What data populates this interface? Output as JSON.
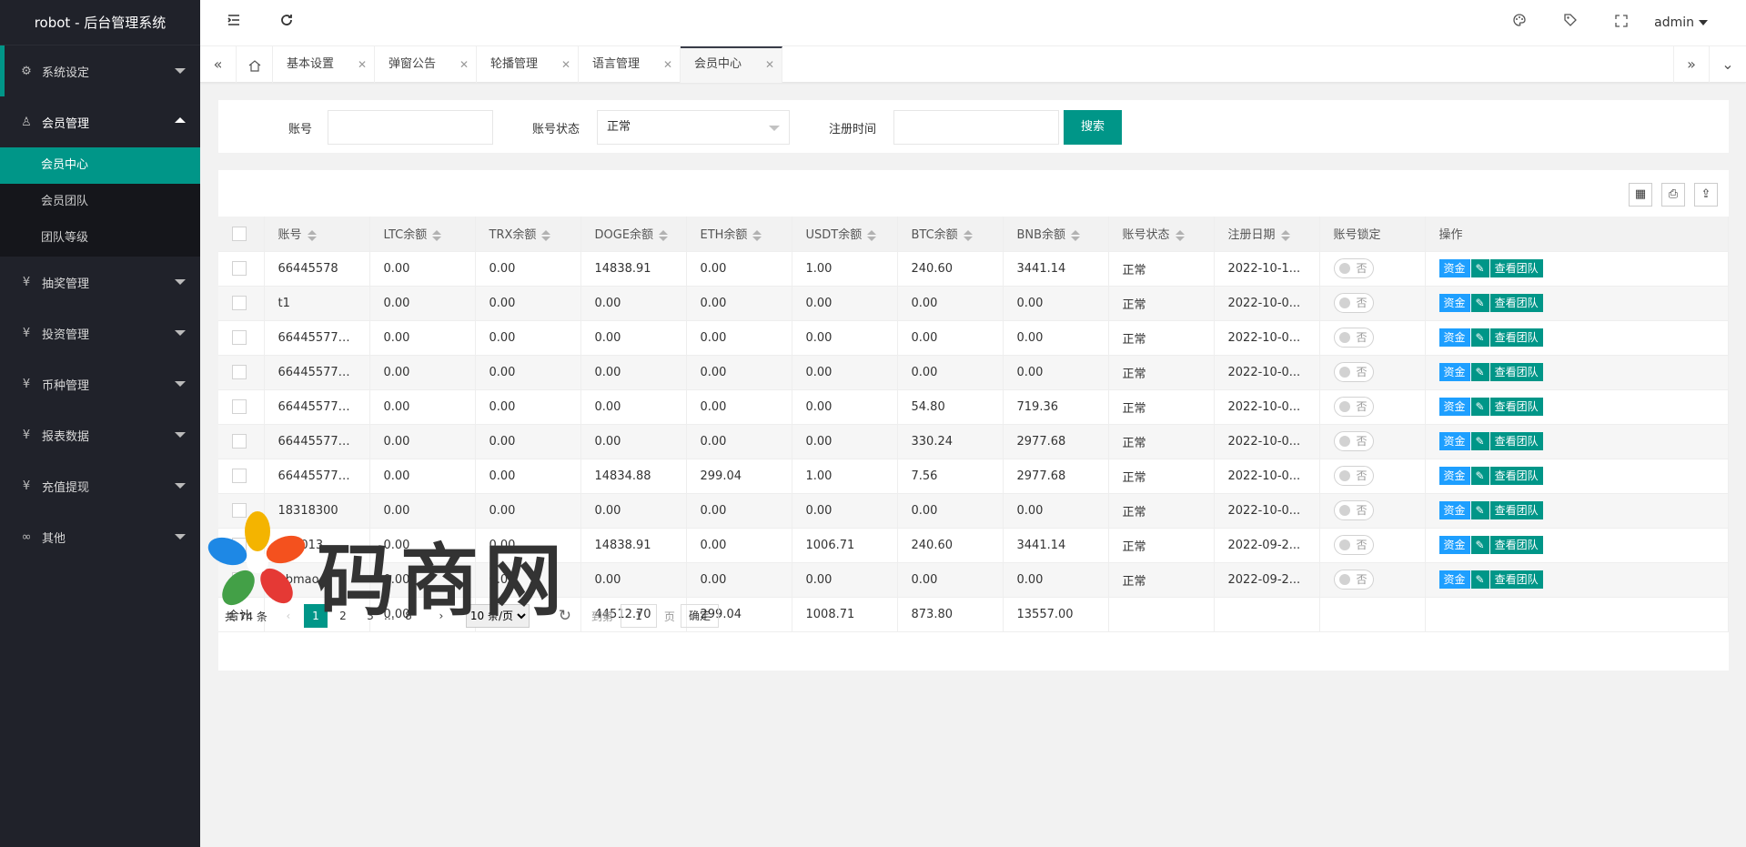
{
  "app": {
    "title": "robot - 后台管理系统"
  },
  "sidebar": {
    "items": [
      {
        "label": "系统设定",
        "icon": "gear-icon",
        "glyph": "⚙"
      },
      {
        "label": "会员管理",
        "icon": "user-icon",
        "glyph": "♙"
      },
      {
        "label": "抽奖管理",
        "icon": "yen-icon",
        "glyph": "¥"
      },
      {
        "label": "投资管理",
        "icon": "yen-icon",
        "glyph": "¥"
      },
      {
        "label": "币种管理",
        "icon": "yen-icon",
        "glyph": "¥"
      },
      {
        "label": "报表数据",
        "icon": "yen-icon",
        "glyph": "¥"
      },
      {
        "label": "充值提现",
        "icon": "yen-icon",
        "glyph": "¥"
      },
      {
        "label": "其他",
        "icon": "infinity-icon",
        "glyph": "∞"
      }
    ],
    "subitems": [
      "会员中心",
      "会员团队",
      "团队等级"
    ]
  },
  "header": {
    "user": "admin"
  },
  "tabs": [
    "基本设置",
    "弹窗公告",
    "轮播管理",
    "语言管理",
    "会员中心"
  ],
  "search": {
    "account_label": "账号",
    "account_value": "",
    "status_label": "账号状态",
    "status_value": "正常",
    "regtime_label": "注册时间",
    "regtime_value": "",
    "button": "搜索"
  },
  "table": {
    "headers": [
      "账号",
      "LTC余额",
      "TRX余额",
      "DOGE余额",
      "ETH余额",
      "USDT余额",
      "BTC余额",
      "BNB余额",
      "账号状态",
      "注册日期",
      "账号锁定",
      "操作"
    ],
    "rows": [
      [
        "66445578",
        "0.00",
        "0.00",
        "14838.91",
        "0.00",
        "1.00",
        "240.60",
        "3441.14",
        "正常",
        "2022-10-1..."
      ],
      [
        "t1",
        "0.00",
        "0.00",
        "0.00",
        "0.00",
        "0.00",
        "0.00",
        "0.00",
        "正常",
        "2022-10-0..."
      ],
      [
        "664455770...",
        "0.00",
        "0.00",
        "0.00",
        "0.00",
        "0.00",
        "0.00",
        "0.00",
        "正常",
        "2022-10-0..."
      ],
      [
        "664455770...",
        "0.00",
        "0.00",
        "0.00",
        "0.00",
        "0.00",
        "0.00",
        "0.00",
        "正常",
        "2022-10-0..."
      ],
      [
        "664455770...",
        "0.00",
        "0.00",
        "0.00",
        "0.00",
        "0.00",
        "54.80",
        "719.36",
        "正常",
        "2022-10-0..."
      ],
      [
        "664455770...",
        "0.00",
        "0.00",
        "0.00",
        "0.00",
        "0.00",
        "330.24",
        "2977.68",
        "正常",
        "2022-10-0..."
      ],
      [
        "664455770...",
        "0.00",
        "0.00",
        "14834.88",
        "299.04",
        "1.00",
        "7.56",
        "2977.68",
        "正常",
        "2022-10-0..."
      ],
      [
        "18318300",
        "0.00",
        "0.00",
        "0.00",
        "0.00",
        "0.00",
        "0.00",
        "0.00",
        "正常",
        "2022-10-0..."
      ],
      [
        "000013",
        "0.00",
        "0.00",
        "14838.91",
        "0.00",
        "1006.71",
        "240.60",
        "3441.14",
        "正常",
        "2022-09-2..."
      ],
      [
        "bbmao",
        "0.00",
        "0.00",
        "0.00",
        "0.00",
        "0.00",
        "0.00",
        "0.00",
        "正常",
        "2022-09-2..."
      ]
    ],
    "lock_label": "否",
    "ops": [
      "资金",
      "✎",
      "查看团队"
    ],
    "total_label": "合计",
    "totals": [
      "0.00",
      "0.00",
      "44512.70",
      "299.04",
      "1008.71",
      "873.80",
      "13557.00"
    ]
  },
  "pager": {
    "total": "共 74 条",
    "pages": [
      "1",
      "2",
      "3",
      "…",
      "8"
    ],
    "page_size": "10 条/页",
    "goto_label": "到第",
    "goto_value": "1",
    "page_unit": "页",
    "confirm": "确定"
  },
  "watermark": {
    "text": "码商网"
  }
}
